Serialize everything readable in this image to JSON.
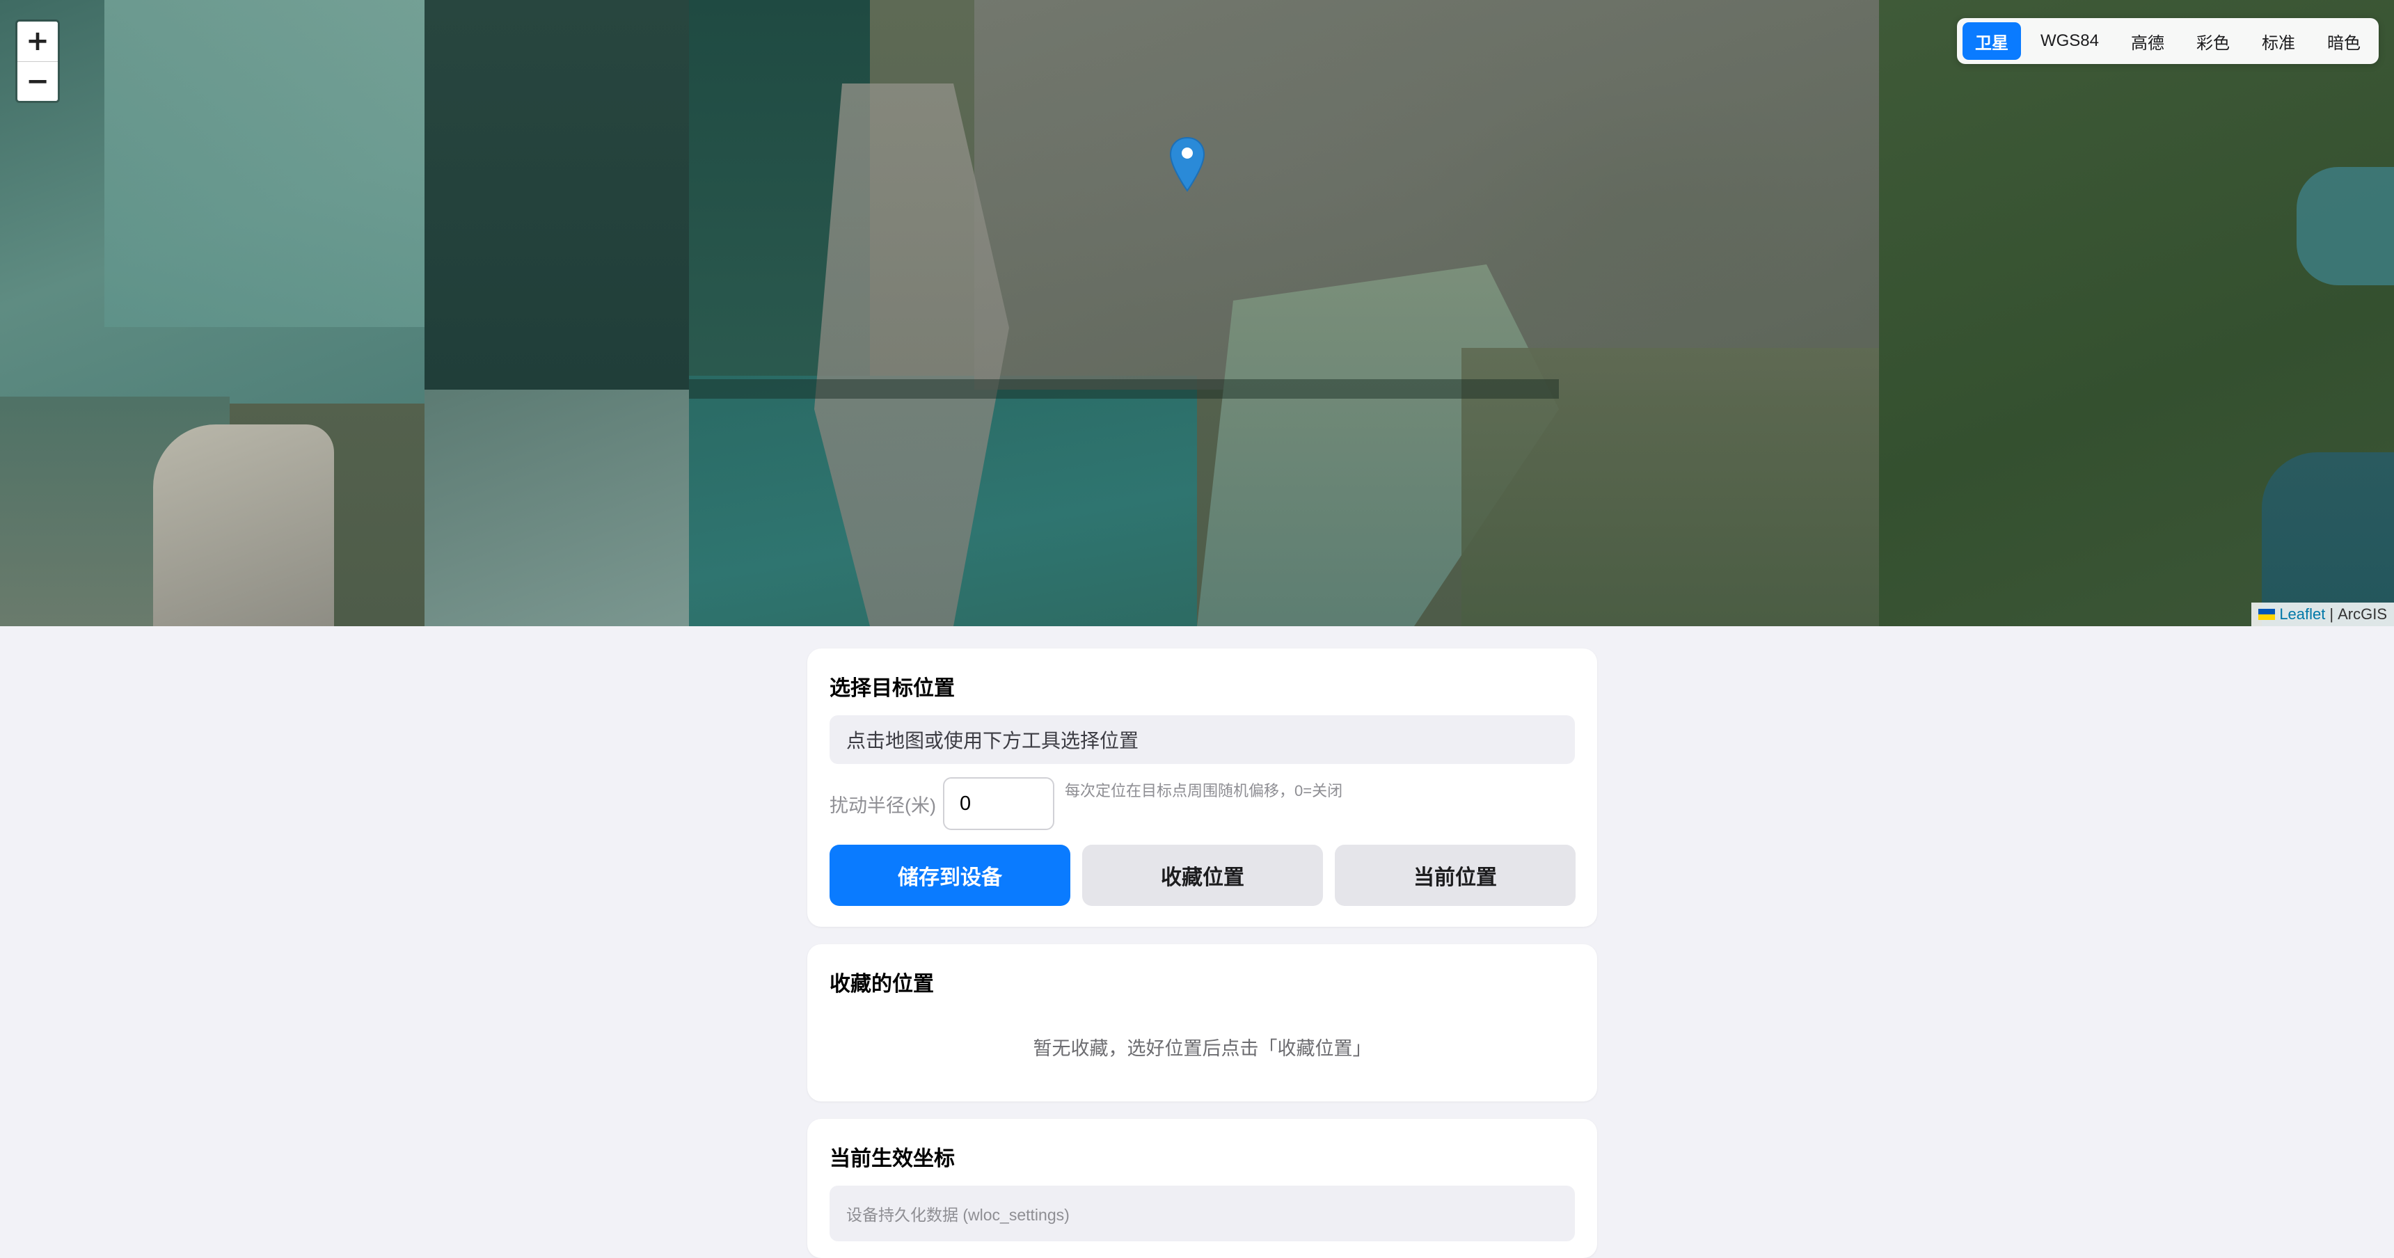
{
  "map": {
    "zoom_in": "+",
    "zoom_out": "−",
    "layers": [
      {
        "label": "卫星",
        "active": true
      },
      {
        "label": "WGS84",
        "active": false
      },
      {
        "label": "高德",
        "active": false
      },
      {
        "label": "彩色",
        "active": false
      },
      {
        "label": "标准",
        "active": false
      },
      {
        "label": "暗色",
        "active": false
      }
    ],
    "marker_icon": "map-pin-icon",
    "attribution": {
      "leaflet": "Leaflet",
      "separator": "|",
      "provider": "ArcGIS"
    }
  },
  "target": {
    "title": "选择目标位置",
    "hint": "点击地图或使用下方工具选择位置",
    "radius_label": "扰动半径(米)",
    "radius_value": "0",
    "radius_note": "每次定位在目标点周围随机偏移，0=关闭",
    "save_button": "储存到设备",
    "favorite_button": "收藏位置",
    "current_button": "当前位置"
  },
  "favorites": {
    "title": "收藏的位置",
    "empty": "暂无收藏，选好位置后点击「收藏位置」"
  },
  "effective": {
    "title": "当前生效坐标",
    "note": "设备持久化数据 (wloc_settings)"
  },
  "colors": {
    "accent": "#0a7bff",
    "background": "#f2f2f7",
    "secondary_button": "#e5e5ea"
  }
}
